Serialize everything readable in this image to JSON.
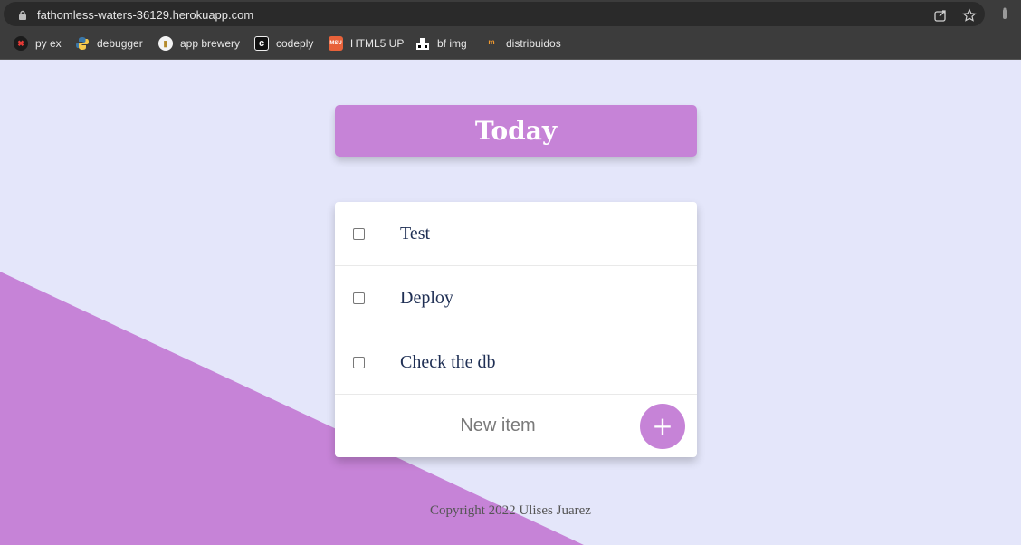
{
  "browser": {
    "url": "fathomless-waters-36129.herokuapp.com",
    "bookmarks": [
      {
        "label": "py ex"
      },
      {
        "label": "debugger"
      },
      {
        "label": "app brewery"
      },
      {
        "label": "codeply"
      },
      {
        "label": "HTML5 UP"
      },
      {
        "label": "bf img"
      },
      {
        "label": "distribuidos"
      }
    ]
  },
  "app": {
    "title": "Today",
    "items": [
      {
        "label": "Test",
        "checked": false
      },
      {
        "label": "Deploy",
        "checked": false
      },
      {
        "label": "Check the db",
        "checked": false
      }
    ],
    "new_item_placeholder": "New item",
    "add_button_label": "+",
    "footer": "Copyright 2022 Ulises Juarez"
  },
  "colors": {
    "accent": "#c683d7",
    "background": "#e4e6fa",
    "item_text": "#1f2f54"
  }
}
